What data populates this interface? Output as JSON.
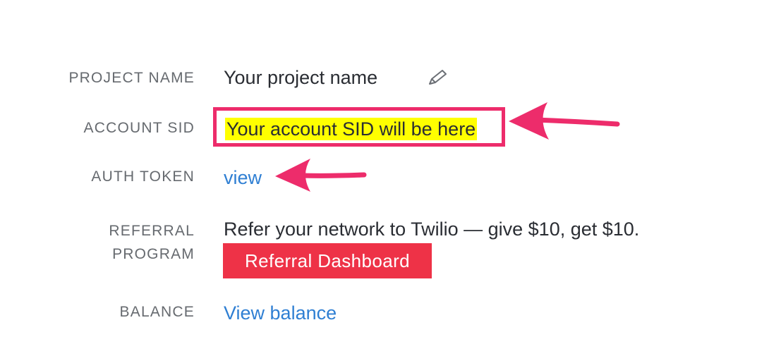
{
  "fields": {
    "project_name": {
      "label": "PROJECT NAME",
      "value": "Your project name"
    },
    "account_sid": {
      "label": "ACCOUNT SID",
      "value": "Your account SID will be here"
    },
    "auth_token": {
      "label": "AUTH TOKEN",
      "link": "view"
    },
    "referral": {
      "label_line1": "REFERRAL",
      "label_line2": "PROGRAM",
      "text": "Refer your network to Twilio — give $10, get $10.",
      "button_label": "Referral Dashboard"
    },
    "balance": {
      "label": "BALANCE",
      "link": "View balance"
    }
  },
  "icons": {
    "edit": "pencil-icon"
  },
  "annotations": {
    "arrow_color": "#ed2c6b",
    "highlight_color": "#ffff00",
    "box_border_color": "#ed2c6b"
  },
  "colors": {
    "label": "#666a6f",
    "text": "#2a2d33",
    "link": "#2f7fd3",
    "button_bg": "#ee3247",
    "button_text": "#ffffff"
  }
}
